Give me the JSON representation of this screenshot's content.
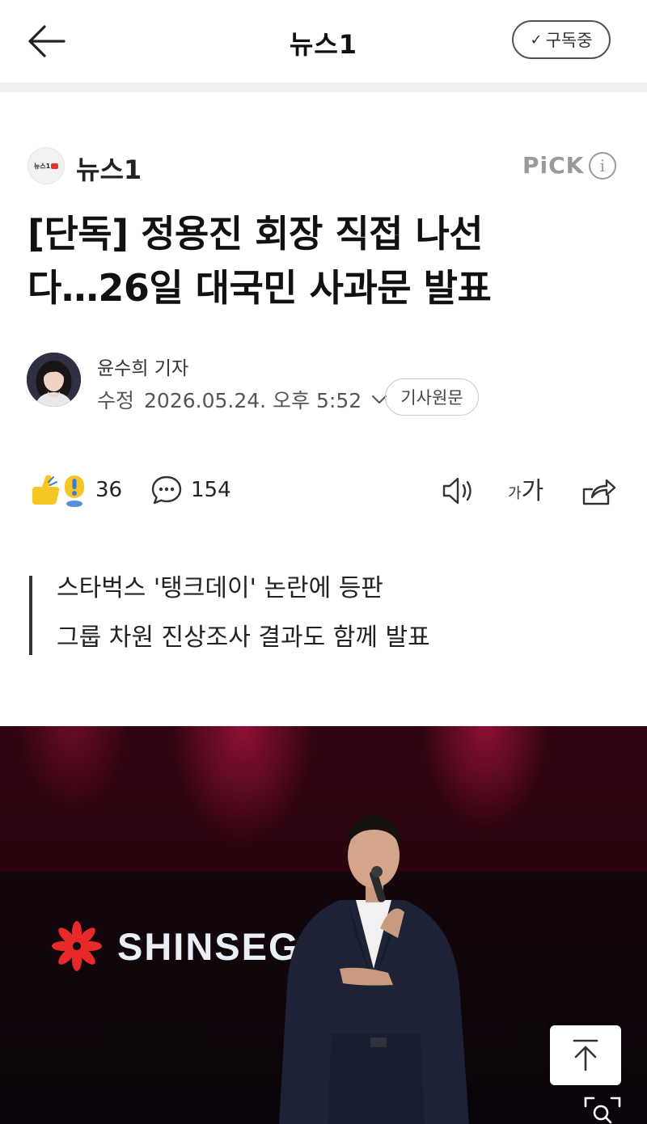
{
  "header": {
    "title": "뉴스1",
    "subscribe_label": "구독중"
  },
  "press": {
    "name": "뉴스1",
    "logo_text": "뉴스1",
    "pick_label": "PiCK",
    "info_label": "i"
  },
  "article": {
    "headline_line1": "[단독] 정용진 회장 직접 나선",
    "headline_line2": "다…26일 대국민 사과문 발표",
    "author": "윤수희 기자",
    "date_label": "수정",
    "date_value": "2026.05.24. 오후 5:52",
    "original_button": "기사원문",
    "summary": [
      "스타벅스 '탱크데이' 논란에 등판",
      "그룹 차원 진상조사 결과도 함께 발표"
    ]
  },
  "actions": {
    "reaction_count": "36",
    "comment_count": "154",
    "font_small": "가",
    "font_large": "가"
  },
  "photo": {
    "sign_text": "SHINSEG"
  },
  "colors": {
    "press_logo_accent": "#e5322d",
    "emoji_yellow": "#f6c624",
    "emoji_blue": "#3a7bd5",
    "photo_red": "#8a0f2b",
    "sign_text": "#e9eef7"
  },
  "icons": {
    "back": "back-arrow-icon",
    "subscribed": "check-icon",
    "info": "info-icon",
    "chevron": "chevron-down-icon",
    "reaction": "thumbs-up-surprise-icon",
    "comment": "comment-bubble-icon",
    "speaker": "speaker-icon",
    "share": "share-icon",
    "scroll_top": "scroll-top-icon",
    "zoom": "zoom-icon"
  }
}
